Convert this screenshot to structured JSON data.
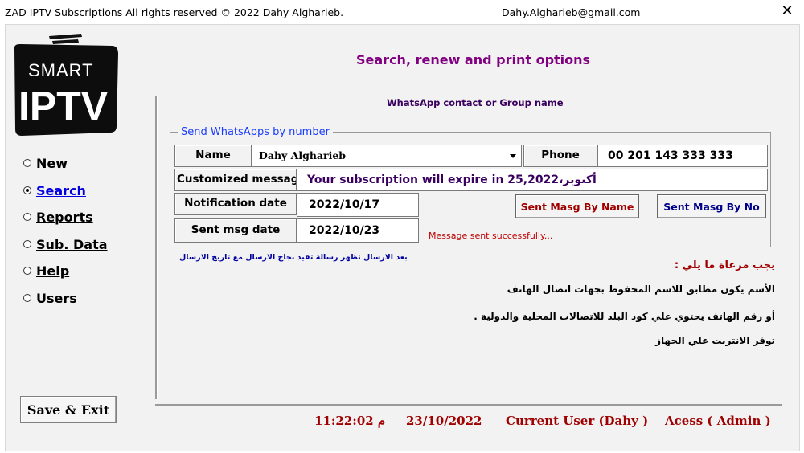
{
  "window": {
    "title": "ZAD IPTV Subscriptions All rights reserved © 2022 Dahy Algharieb.",
    "email": "Dahy.Algharieb@gmail.com",
    "close_glyph": "✕"
  },
  "logo": {
    "line1": "SMART",
    "line2": "IPTV"
  },
  "nav": {
    "new": "New",
    "search": "Search",
    "reports": "Reports",
    "sub_data": "Sub. Data",
    "help": "Help",
    "users": "Users"
  },
  "save_exit": "Save & Exit",
  "main": {
    "heading": "Search, renew and print options",
    "subheading": "WhatsApp contact or Group name",
    "group_title": "Send WhatsApps by number",
    "name_label": "Name",
    "name_value": "Dahy Algharieb",
    "phone_label": "Phone",
    "phone_value": "00 201 143 333 333",
    "message_label": "Customized messag",
    "message_value": "Your subscription will expire in 25,2022،أكتوبر",
    "notification_label": "Notification date",
    "notification_value": "2022/10/17",
    "sent_label": "Sent msg date",
    "sent_value": "2022/10/23",
    "btn_by_name": "Sent Masg By Name",
    "btn_by_no": "Sent Masg By No",
    "status": "Message sent successfully...",
    "note": "بعد الارسال تظهر رسالة تفيد نجاح الارسال مع تاريخ الارسال"
  },
  "instructions": {
    "title": "يجب مرعاة ما يلي :",
    "line1": "الأسم يكون مطابق للاسم المحفوظ بجهات اتصال الهاتف",
    "line2": "أو رقم الهاتف يحتوي علي كود البلد للاتصالات المحلية والدولية .",
    "line3": "توفر الانترنت علي الجهاز"
  },
  "footer": {
    "time": "11:22:02 م",
    "date": "23/10/2022",
    "user": "Current User (Dahy  )",
    "access": "Acess ( Admin )"
  },
  "colors": {
    "heading": "#800080",
    "legend": "#1a3cff",
    "status": "#c00000",
    "footer": "#a00000",
    "note": "#0000a0",
    "active_nav": "#0000e0",
    "message_text": "#3a0060",
    "btn_by_name": "#a00000",
    "btn_by_no": "#00008b"
  }
}
